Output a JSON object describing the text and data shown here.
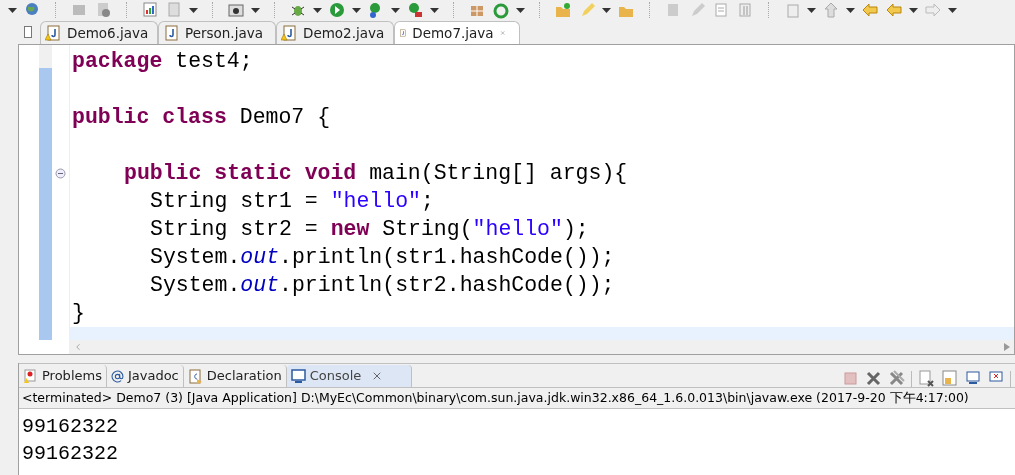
{
  "editor_tabs": [
    {
      "label": "Demo6.java",
      "selected": false,
      "warning": true
    },
    {
      "label": "Person.java",
      "selected": false,
      "warning": false
    },
    {
      "label": "Demo2.java",
      "selected": false,
      "warning": true
    },
    {
      "label": "Demo7.java",
      "selected": true,
      "warning": false
    }
  ],
  "code_lines": [
    {
      "kind": "top",
      "tokens": [
        {
          "kind": "keyword",
          "text": "package"
        },
        {
          "kind": "plain",
          "text": " test4;"
        }
      ]
    },
    {
      "kind": "blank"
    },
    {
      "kind": "top",
      "tokens": [
        {
          "kind": "keyword",
          "text": "public class"
        },
        {
          "kind": "plain",
          "text": " Demo7 "
        },
        {
          "kind": "bracket",
          "text": "{"
        }
      ]
    },
    {
      "kind": "blank"
    },
    {
      "kind": "method",
      "fold": true,
      "tokens": [
        {
          "kind": "keyword",
          "text": "public static void"
        },
        {
          "kind": "plain",
          "text": " main(String[] args){"
        }
      ]
    },
    {
      "kind": "statement",
      "tokens": [
        {
          "kind": "plain",
          "text": "String str1 = "
        },
        {
          "kind": "string",
          "text": "\"hello\""
        },
        {
          "kind": "plain",
          "text": ";"
        }
      ]
    },
    {
      "kind": "statement",
      "tokens": [
        {
          "kind": "plain",
          "text": "String str2 = "
        },
        {
          "kind": "keyword",
          "text": "new"
        },
        {
          "kind": "plain",
          "text": " String("
        },
        {
          "kind": "string",
          "text": "\"hello\""
        },
        {
          "kind": "plain",
          "text": ");"
        }
      ]
    },
    {
      "kind": "statement",
      "tokens": [
        {
          "kind": "plain",
          "text": "System."
        },
        {
          "kind": "field",
          "text": "out"
        },
        {
          "kind": "plain",
          "text": ".println(str1.hashCode());"
        }
      ]
    },
    {
      "kind": "statement",
      "tokens": [
        {
          "kind": "plain",
          "text": "System."
        },
        {
          "kind": "field",
          "text": "out"
        },
        {
          "kind": "plain",
          "text": ".println(str2.hashCode());"
        }
      ]
    },
    {
      "kind": "top",
      "tokens": [
        {
          "kind": "bracket",
          "text": "}"
        }
      ]
    },
    {
      "kind": "blank",
      "current": true
    }
  ],
  "view_tabs": [
    {
      "label": "Problems",
      "kind": "problems",
      "selected": false
    },
    {
      "label": "Javadoc",
      "kind": "javadoc",
      "selected": false
    },
    {
      "label": "Declaration",
      "kind": "declaration",
      "selected": false
    },
    {
      "label": "Console",
      "kind": "console",
      "selected": true
    }
  ],
  "console": {
    "header": "<terminated> Demo7 (3) [Java Application] D:\\MyEc\\Common\\binary\\com.sun.java.jdk.win32.x86_64_1.6.0.013\\bin\\javaw.exe (2017-9-20 下午4:17:00)",
    "output": [
      "99162322",
      "99162322"
    ]
  }
}
